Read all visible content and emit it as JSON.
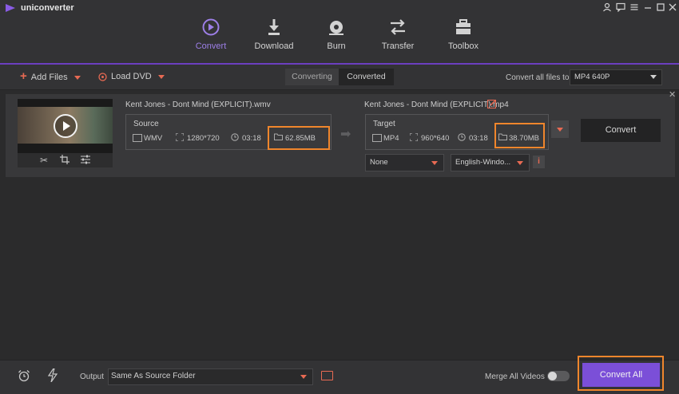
{
  "app": {
    "name": "uniconverter"
  },
  "nav": [
    {
      "label": "Convert",
      "icon": "convert-icon",
      "active": true
    },
    {
      "label": "Download",
      "icon": "download-icon",
      "active": false
    },
    {
      "label": "Burn",
      "icon": "burn-icon",
      "active": false
    },
    {
      "label": "Transfer",
      "icon": "transfer-icon",
      "active": false
    },
    {
      "label": "Toolbox",
      "icon": "toolbox-icon",
      "active": false
    }
  ],
  "toolbar": {
    "add_files": "Add Files",
    "load_dvd": "Load DVD",
    "tabs": [
      "Converting",
      "Converted"
    ],
    "convert_all_files_to": "Convert all files to:",
    "format": "MP4 640P"
  },
  "file": {
    "source_name": "Kent Jones - Dont Mind (EXPLICIT).wmv",
    "target_name": "Kent Jones - Dont Mind (EXPLICIT).mp4",
    "source": {
      "title": "Source",
      "format": "WMV",
      "resolution": "1280*720",
      "duration": "03:18",
      "size": "62.85MB"
    },
    "target": {
      "title": "Target",
      "format": "MP4",
      "resolution": "960*640",
      "duration": "03:18",
      "size": "38.70MB"
    },
    "subtitle": "None",
    "audio": "English-Windo...",
    "convert_label": "Convert"
  },
  "bottom": {
    "output_label": "Output",
    "output_value": "Same As Source Folder",
    "merge_label": "Merge All Videos",
    "merge_on": false,
    "convert_all": "Convert All"
  },
  "colors": {
    "accent": "#7b4fd8",
    "highlight": "#f0862c",
    "orange_icon": "#e86a53"
  }
}
